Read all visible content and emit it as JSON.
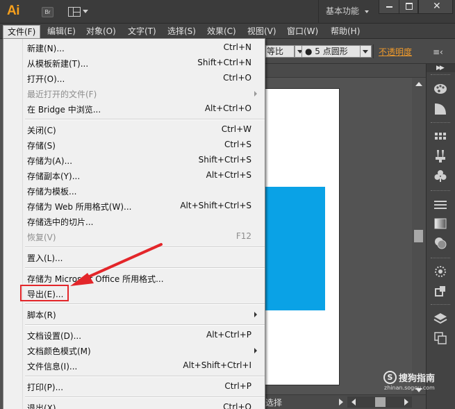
{
  "app": {
    "logo": "Ai",
    "bridge_button": "Br",
    "workspace": "基本功能"
  },
  "menubar": {
    "items": [
      {
        "label": "文件(F)",
        "active": true
      },
      {
        "label": "编辑(E)"
      },
      {
        "label": "对象(O)"
      },
      {
        "label": "文字(T)"
      },
      {
        "label": "选择(S)"
      },
      {
        "label": "效果(C)"
      },
      {
        "label": "视图(V)"
      },
      {
        "label": "窗口(W)"
      },
      {
        "label": "帮助(H)"
      }
    ]
  },
  "controlbar": {
    "ratio_value": "等比",
    "brush_value": "● 5 点圆形",
    "opacity_label": "不透明度"
  },
  "statusbar": {
    "text": "选择"
  },
  "file_menu": {
    "items": [
      {
        "label": "新建(N)...",
        "shortcut": "Ctrl+N"
      },
      {
        "label": "从模板新建(T)...",
        "shortcut": "Shift+Ctrl+N"
      },
      {
        "label": "打开(O)...",
        "shortcut": "Ctrl+O"
      },
      {
        "label": "最近打开的文件(F)",
        "shortcut": "",
        "disabled": true,
        "submenu": true
      },
      {
        "label": "在 Bridge 中浏览...",
        "shortcut": "Alt+Ctrl+O"
      },
      {
        "label": "关闭(C)",
        "shortcut": "Ctrl+W"
      },
      {
        "label": "存储(S)",
        "shortcut": "Ctrl+S"
      },
      {
        "label": "存储为(A)...",
        "shortcut": "Shift+Ctrl+S"
      },
      {
        "label": "存储副本(Y)...",
        "shortcut": "Alt+Ctrl+S"
      },
      {
        "label": "存储为模板...",
        "shortcut": ""
      },
      {
        "label": "存储为 Web 所用格式(W)...",
        "shortcut": "Alt+Shift+Ctrl+S"
      },
      {
        "label": "存储选中的切片...",
        "shortcut": ""
      },
      {
        "label": "恢复(V)",
        "shortcut": "F12",
        "disabled": true
      },
      {
        "label": "置入(L)...",
        "shortcut": ""
      },
      {
        "label": "存储为 Microsoft Office 所用格式...",
        "shortcut": ""
      },
      {
        "label": "导出(E)...",
        "shortcut": ""
      },
      {
        "label": "脚本(R)",
        "shortcut": "",
        "submenu": true
      },
      {
        "label": "文档设置(D)...",
        "shortcut": "Alt+Ctrl+P"
      },
      {
        "label": "文档颜色模式(M)",
        "shortcut": "",
        "submenu": true
      },
      {
        "label": "文件信息(I)...",
        "shortcut": "Alt+Shift+Ctrl+I"
      },
      {
        "label": "打印(P)...",
        "shortcut": "Ctrl+P"
      },
      {
        "label": "退出(X)",
        "shortcut": "Ctrl+Q"
      }
    ]
  },
  "watermark": {
    "logo_glyph": "S",
    "text": "搜狗指南",
    "url": "zhinan.sogou.com"
  },
  "colors": {
    "accent_orange": "#f7a01c",
    "annotation_red": "#e3262a",
    "shape_blue": "#0aa2e6"
  }
}
